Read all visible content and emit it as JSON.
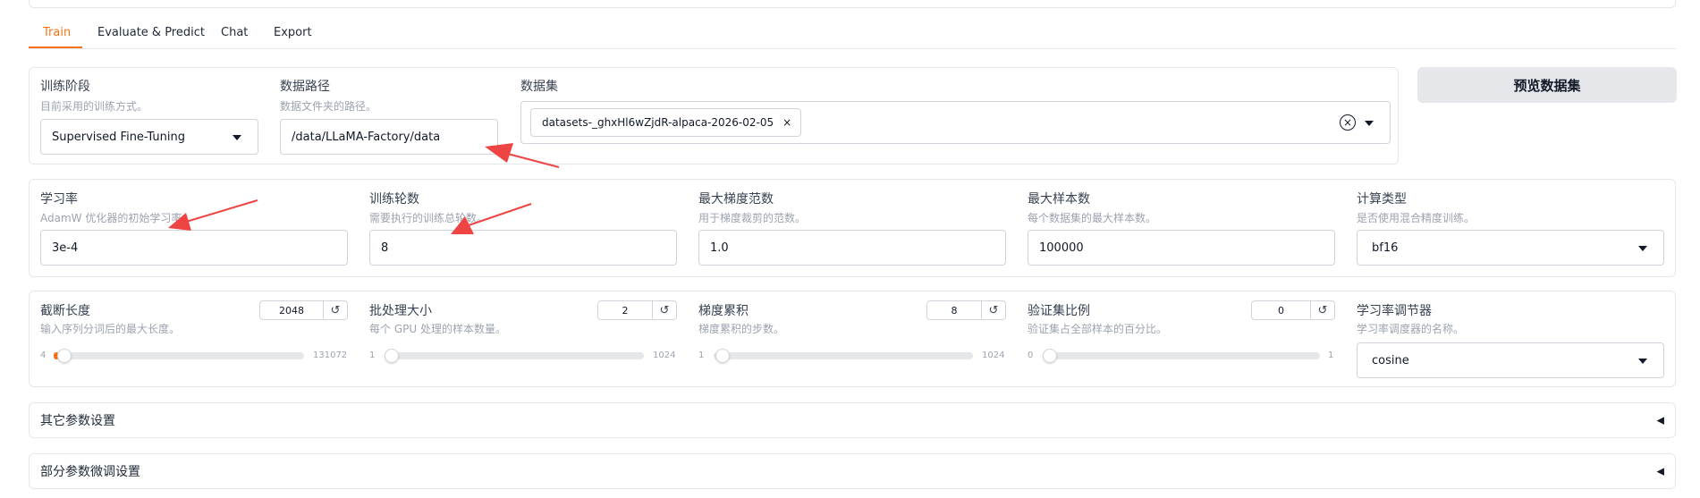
{
  "tabs": [
    {
      "label": "Train",
      "active": true
    },
    {
      "label": "Evaluate & Predict"
    },
    {
      "label": "Chat"
    },
    {
      "label": "Export"
    }
  ],
  "accent_color": "#f97316",
  "arrow_color": "#ef4444",
  "row1": {
    "stage": {
      "label": "训练阶段",
      "info": "目前采用的训练方式。",
      "value": "Supervised Fine-Tuning"
    },
    "dataset_dir": {
      "label": "数据路径",
      "info": "数据文件夹的路径。",
      "value": "/data/LLaMA-Factory/data"
    },
    "dataset": {
      "label": "数据集",
      "chip": "datasets-_ghxHl6wZjdR-alpaca-2026-02-05",
      "chip_close": "×",
      "clear": "×"
    },
    "preview_button": "预览数据集"
  },
  "row2": {
    "learning_rate": {
      "label": "学习率",
      "info": "AdamW 优化器的初始学习率。",
      "value": "3e-4"
    },
    "num_epochs": {
      "label": "训练轮数",
      "info": "需要执行的训练总轮数。",
      "value": "8"
    },
    "max_grad_norm": {
      "label": "最大梯度范数",
      "info": "用于梯度裁剪的范数。",
      "value": "1.0"
    },
    "max_samples": {
      "label": "最大样本数",
      "info": "每个数据集的最大样本数。",
      "value": "100000"
    },
    "compute_type": {
      "label": "计算类型",
      "info": "是否使用混合精度训练。",
      "value": "bf16"
    }
  },
  "row3": {
    "cutoff_len": {
      "label": "截断长度",
      "info": "输入序列分词后的最大长度。",
      "value": "2048",
      "min": "4",
      "max": "131072",
      "fraction": 0.016
    },
    "batch_size": {
      "label": "批处理大小",
      "info": "每个 GPU 处理的样本数量。",
      "value": "2",
      "min": "1",
      "max": "1024",
      "fraction": 0.001
    },
    "grad_accum": {
      "label": "梯度累积",
      "info": "梯度累积的步数。",
      "value": "8",
      "min": "1",
      "max": "1024",
      "fraction": 0.007
    },
    "val_size": {
      "label": "验证集比例",
      "info": "验证集占全部样本的百分比。",
      "value": "0",
      "min": "0",
      "max": "1",
      "fraction": 0
    },
    "lr_scheduler": {
      "label": "学习率调节器",
      "info": "学习率调度器的名称。",
      "value": "cosine"
    }
  },
  "accordions": [
    {
      "label": "其它参数设置",
      "arrow": "◀"
    },
    {
      "label": "部分参数微调设置",
      "arrow": "◀"
    }
  ]
}
